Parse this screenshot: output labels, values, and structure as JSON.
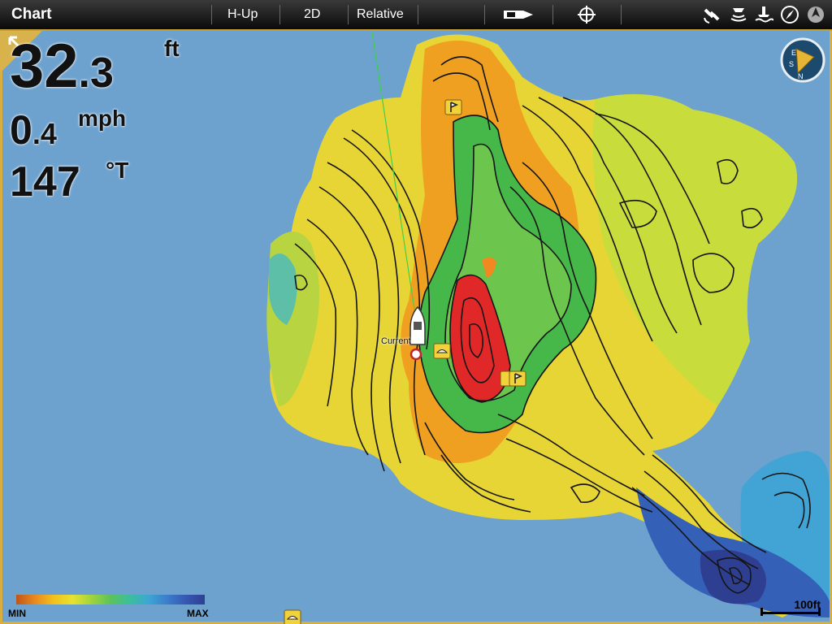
{
  "topbar": {
    "title": "Chart",
    "orientation": "H-Up",
    "view_mode": "2D",
    "motion_mode": "Relative",
    "icons": [
      "boat-toggle-icon",
      "crosshair-icon",
      "gps-satellite-icon",
      "sonar-icon",
      "depth-icon",
      "compass-icon",
      "wind-icon"
    ]
  },
  "readouts": {
    "depth_value": "32",
    "depth_decimal": ".3",
    "depth_unit": "ft",
    "speed_value": "0",
    "speed_decimal": ".4",
    "speed_unit": "mph",
    "heading_value": "147",
    "heading_unit": "°T"
  },
  "compass": {
    "north": "N",
    "east": "E",
    "south": "S"
  },
  "boat_label": "Current",
  "legend": {
    "min_label": "MIN",
    "max_label": "MAX"
  },
  "scale": {
    "label": "100ft"
  },
  "colors": {
    "water": "#6da2cf",
    "accent_border": "#d9ae3e",
    "shallow": "#d94420",
    "deep": "#2e3f92"
  }
}
